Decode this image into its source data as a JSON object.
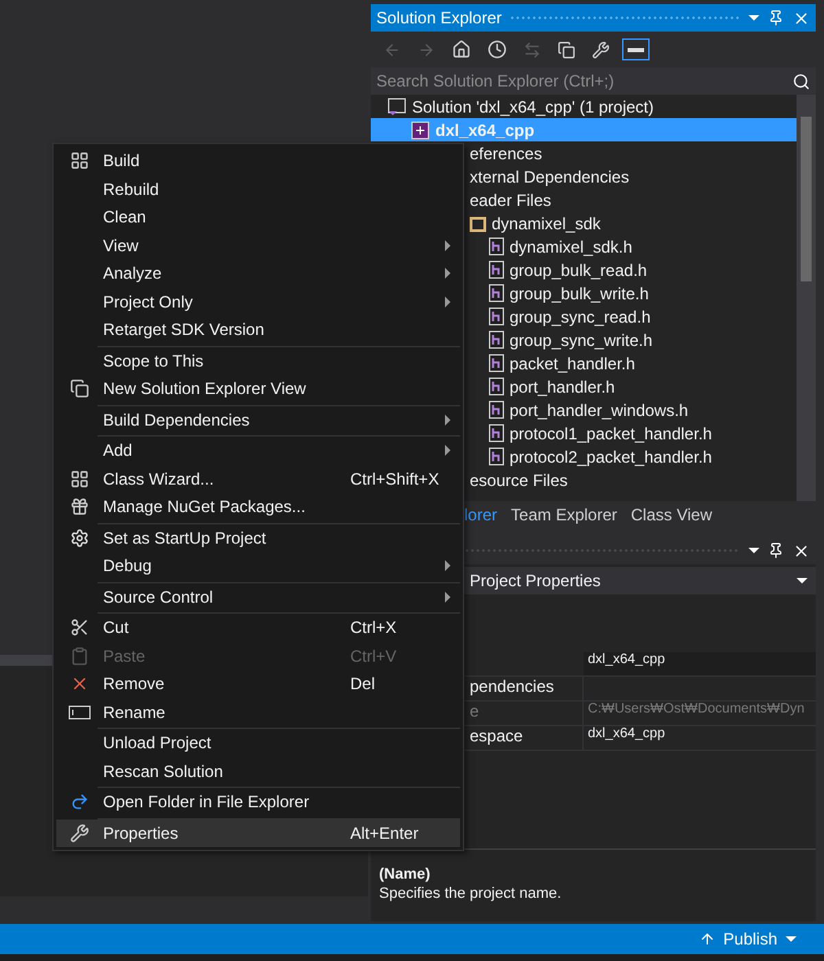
{
  "solution_explorer": {
    "title": "Solution Explorer",
    "search": {
      "placeholder": "Search Solution Explorer (Ctrl+;)"
    },
    "tree": [
      {
        "label": "Solution 'dxl_x64_cpp' (1 project)",
        "kind": "solution",
        "selected": false,
        "children": [
          {
            "label": "dxl_x64_cpp",
            "kind": "project",
            "selected": true,
            "children": [
              {
                "label": "eferences",
                "selected": false
              },
              {
                "label": "xternal Dependencies",
                "selected": false
              },
              {
                "label": "eader Files",
                "selected": false,
                "children": [
                  {
                    "label": "dynamixel_sdk",
                    "kind": "folder",
                    "selected": false,
                    "children": [
                      {
                        "label": "dynamixel_sdk.h",
                        "kind": "header",
                        "selected": false
                      },
                      {
                        "label": "group_bulk_read.h",
                        "kind": "header",
                        "selected": false
                      },
                      {
                        "label": "group_bulk_write.h",
                        "kind": "header",
                        "selected": false
                      },
                      {
                        "label": "group_sync_read.h",
                        "kind": "header",
                        "selected": false
                      },
                      {
                        "label": "group_sync_write.h",
                        "kind": "header",
                        "selected": false
                      },
                      {
                        "label": "packet_handler.h",
                        "kind": "header",
                        "selected": false
                      },
                      {
                        "label": "port_handler.h",
                        "kind": "header",
                        "selected": false
                      },
                      {
                        "label": "port_handler_windows.h",
                        "kind": "header",
                        "selected": false
                      },
                      {
                        "label": "protocol1_packet_handler.h",
                        "kind": "header",
                        "selected": false
                      },
                      {
                        "label": "protocol2_packet_handler.h",
                        "kind": "header",
                        "selected": false
                      }
                    ]
                  }
                ]
              },
              {
                "label": "esource Files",
                "selected": false
              }
            ]
          }
        ]
      }
    ],
    "tabs": [
      {
        "label": "lorer",
        "selected": true
      },
      {
        "label": "Team Explorer",
        "selected": false
      },
      {
        "label": "Class View",
        "selected": false
      }
    ]
  },
  "properties": {
    "object": "Project Properties",
    "rows": [
      {
        "value": "dxl_x64_cpp",
        "disabled": false
      },
      {
        "label": "pendencies",
        "disabled": false
      },
      {
        "label": "e",
        "value": "C:₩Users₩Ost₩Documents₩Dyn",
        "disabled": true
      },
      {
        "label": "espace",
        "value": "dxl_x64_cpp",
        "disabled": false
      }
    ],
    "description": {
      "title": "(Name)",
      "text": "Specifies the project name."
    }
  },
  "status_bar": {
    "publish": "Publish"
  },
  "context_menu": {
    "sections": [
      [
        {
          "label": "Build",
          "kind": "build",
          "submenu": false,
          "disabled": false,
          "highlighted": false
        },
        {
          "label": "Rebuild",
          "kind": "plain",
          "submenu": false,
          "disabled": false,
          "highlighted": false
        },
        {
          "label": "Clean",
          "kind": "plain",
          "submenu": false,
          "disabled": false,
          "highlighted": false
        },
        {
          "label": "View",
          "kind": "plain",
          "submenu": true,
          "disabled": false,
          "highlighted": false
        },
        {
          "label": "Analyze",
          "kind": "plain",
          "submenu": true,
          "disabled": false,
          "highlighted": false
        },
        {
          "label": "Project Only",
          "kind": "plain",
          "submenu": true,
          "disabled": false,
          "highlighted": false
        },
        {
          "label": "Retarget SDK Version",
          "kind": "plain",
          "submenu": false,
          "disabled": false,
          "highlighted": false
        }
      ],
      [
        {
          "label": "Scope to This",
          "kind": "plain",
          "submenu": false,
          "disabled": false,
          "highlighted": false
        },
        {
          "label": "New Solution Explorer View",
          "kind": "windows",
          "submenu": false,
          "disabled": false,
          "highlighted": false
        }
      ],
      [
        {
          "label": "Build Dependencies",
          "kind": "plain",
          "submenu": true,
          "disabled": false,
          "highlighted": false
        }
      ],
      [
        {
          "label": "Add",
          "kind": "plain",
          "submenu": true,
          "disabled": false,
          "highlighted": false
        },
        {
          "label": "Class Wizard...",
          "kind": "wizard",
          "shortcut": "Ctrl+Shift+X",
          "submenu": false,
          "disabled": false,
          "highlighted": false
        },
        {
          "label": "Manage NuGet Packages...",
          "kind": "package",
          "submenu": false,
          "disabled": false,
          "highlighted": false
        }
      ],
      [
        {
          "label": "Set as StartUp Project",
          "kind": "gear",
          "submenu": false,
          "disabled": false,
          "highlighted": false
        },
        {
          "label": "Debug",
          "kind": "plain",
          "submenu": true,
          "disabled": false,
          "highlighted": false
        }
      ],
      [
        {
          "label": "Source Control",
          "kind": "plain",
          "submenu": true,
          "disabled": false,
          "highlighted": false
        }
      ],
      [
        {
          "label": "Cut",
          "kind": "cut",
          "shortcut": "Ctrl+X",
          "submenu": false,
          "disabled": false,
          "highlighted": false
        },
        {
          "label": "Paste",
          "kind": "paste",
          "shortcut": "Ctrl+V",
          "submenu": false,
          "disabled": true,
          "highlighted": false
        },
        {
          "label": "Remove",
          "kind": "remove",
          "shortcut": "Del",
          "submenu": false,
          "disabled": false,
          "highlighted": false
        },
        {
          "label": "Rename",
          "kind": "rename",
          "submenu": false,
          "disabled": false,
          "highlighted": false
        }
      ],
      [
        {
          "label": "Unload Project",
          "kind": "plain",
          "submenu": false,
          "disabled": false,
          "highlighted": false
        },
        {
          "label": "Rescan Solution",
          "kind": "plain",
          "submenu": false,
          "disabled": false,
          "highlighted": false
        }
      ],
      [
        {
          "label": "Open Folder in File Explorer",
          "kind": "open",
          "submenu": false,
          "disabled": false,
          "highlighted": false
        }
      ],
      [
        {
          "label": "Properties",
          "kind": "wrench",
          "shortcut": "Alt+Enter",
          "submenu": false,
          "disabled": false,
          "highlighted": true
        }
      ]
    ]
  }
}
